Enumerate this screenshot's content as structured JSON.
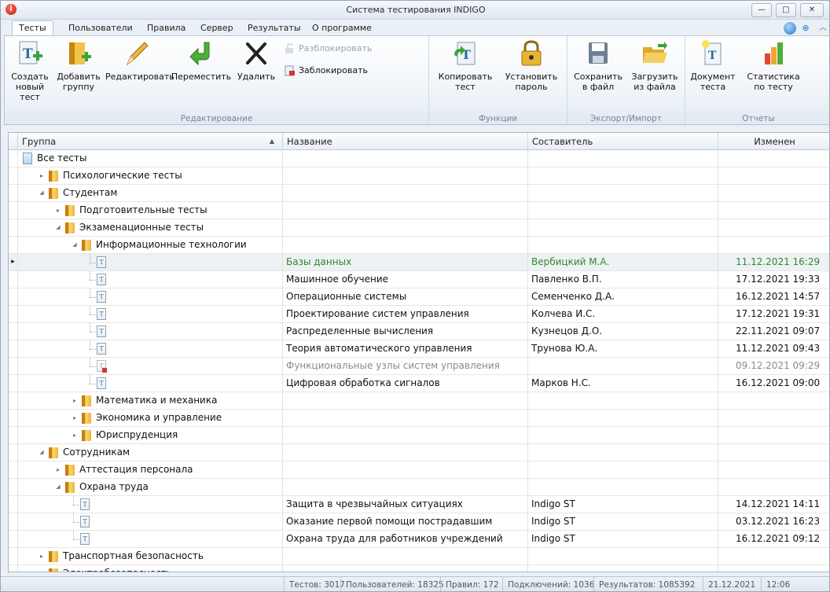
{
  "window": {
    "title": "Система тестирования INDIGO"
  },
  "tabs": [
    "Тесты",
    "Пользователи",
    "Правила",
    "Сервер",
    "Результаты",
    "О программе"
  ],
  "ribbon": {
    "create_test": [
      "Создать",
      "новый тест"
    ],
    "add_group": [
      "Добавить",
      "группу"
    ],
    "edit": "Редактировать",
    "move": "Переместить",
    "delete": "Удалить",
    "unlock": "Разблокировать",
    "lock": "Заблокировать",
    "group_edit": "Редактирование",
    "copy_test": [
      "Копировать",
      "тест"
    ],
    "set_password": [
      "Установить",
      "пароль"
    ],
    "group_functions": "Функции",
    "save_file": [
      "Сохранить",
      "в файл"
    ],
    "load_file": [
      "Загрузить",
      "из файла"
    ],
    "group_io": "Экспорт/Импорт",
    "test_doc": [
      "Документ",
      "теста"
    ],
    "test_stats": [
      "Статистика",
      "по тесту"
    ],
    "group_reports": "Отчеты"
  },
  "grid": {
    "headers": {
      "group": "Группа",
      "name": "Название",
      "author": "Составитель",
      "changed": "Изменен"
    },
    "rows": [
      {
        "kind": "root",
        "label": "Все тесты"
      },
      {
        "kind": "folder",
        "label": "Психологические тесты",
        "state": "collapsed"
      },
      {
        "kind": "folder",
        "label": "Студентам",
        "state": "expanded"
      },
      {
        "kind": "folder",
        "label": "Подготовительные тесты",
        "state": "collapsed"
      },
      {
        "kind": "folder",
        "label": "Экзаменационные тесты",
        "state": "expanded"
      },
      {
        "kind": "folder",
        "label": "Информационные технологии",
        "state": "expanded"
      },
      {
        "kind": "test",
        "name": "Базы данных",
        "author": "Вербицкий М.А.",
        "changed": "11.12.2021 16:29",
        "selected": true
      },
      {
        "kind": "test",
        "name": "Машинное обучение",
        "author": "Павленко В.П.",
        "changed": "17.12.2021 19:33"
      },
      {
        "kind": "test",
        "name": "Операционные системы",
        "author": "Семенченко Д.А.",
        "changed": "16.12.2021 14:57"
      },
      {
        "kind": "test",
        "name": "Проектирование систем управления",
        "author": "Колчева И.С.",
        "changed": "17.12.2021 19:31"
      },
      {
        "kind": "test",
        "name": "Распределенные вычисления",
        "author": "Кузнецов Д.О.",
        "changed": "22.11.2021 09:07"
      },
      {
        "kind": "test",
        "name": "Теория автоматического управления",
        "author": "Трунова Ю.А.",
        "changed": "11.12.2021 09:43"
      },
      {
        "kind": "test",
        "name": "Функциональные узлы систем управления",
        "author": "",
        "changed": "09.12.2021 09:29",
        "locked": true
      },
      {
        "kind": "test",
        "name": "Цифровая обработка сигналов",
        "author": "Марков Н.С.",
        "changed": "16.12.2021 09:00"
      },
      {
        "kind": "folder",
        "label": "Математика и механика",
        "state": "collapsed"
      },
      {
        "kind": "folder",
        "label": "Экономика и управление",
        "state": "collapsed"
      },
      {
        "kind": "folder",
        "label": "Юриспруденция",
        "state": "collapsed"
      },
      {
        "kind": "folder",
        "label": "Сотрудникам",
        "state": "expanded"
      },
      {
        "kind": "folder",
        "label": "Аттестация персонала",
        "state": "collapsed"
      },
      {
        "kind": "folder",
        "label": "Охрана труда",
        "state": "expanded"
      },
      {
        "kind": "test",
        "name": "Защита в чрезвычайных ситуациях",
        "author": "Indigo ST",
        "changed": "14.12.2021 14:11"
      },
      {
        "kind": "test",
        "name": "Оказание первой помощи пострадавшим",
        "author": "Indigo ST",
        "changed": "03.12.2021 16:23"
      },
      {
        "kind": "test",
        "name": "Охрана труда для работников учреждений",
        "author": "Indigo ST",
        "changed": "16.12.2021 09:12"
      },
      {
        "kind": "folder",
        "label": "Транспортная безопасность",
        "state": "collapsed"
      },
      {
        "kind": "folder",
        "label": "Электробезопасность",
        "state": "collapsed"
      }
    ]
  },
  "status": {
    "tests": "Тестов: 3017",
    "users": "Пользователей: 18325",
    "rules": "Правил: 172",
    "connections": "Подключений: 1036",
    "results": "Результатов: 1085392",
    "date": "21.12.2021",
    "time": "12:06"
  }
}
